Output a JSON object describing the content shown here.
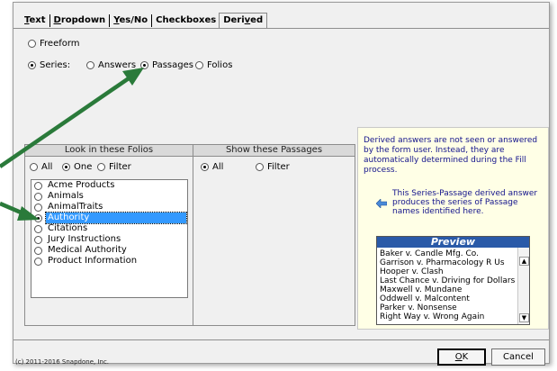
{
  "tabs": [
    {
      "pre": "",
      "ul": "T",
      "post": "ext"
    },
    {
      "pre": "",
      "ul": "D",
      "post": "ropdown"
    },
    {
      "pre": "",
      "ul": "Y",
      "post": "es/No"
    },
    {
      "pre": "Checkboxes",
      "ul": "",
      "post": ""
    },
    {
      "pre": "Deri",
      "ul": "v",
      "post": "ed"
    }
  ],
  "options": {
    "freeform": "Freeform",
    "series": "Series:",
    "answers": "Answers",
    "passages": "Passages",
    "folios": "Folios"
  },
  "panel": {
    "left_head": "Look in these Folios",
    "right_head": "Show these Passages",
    "all": "All",
    "one": "One",
    "filter": "Filter",
    "right_all": "All",
    "right_filter": "Filter"
  },
  "folios": [
    "Acme Products",
    "Animals",
    "AnimalTraits",
    "Authority",
    "Citations",
    "Jury Instructions",
    "Medical Authority",
    "Product Information"
  ],
  "selected_folio": "Authority",
  "info": {
    "text": "Derived answers are not seen or answered by the form user.  Instead, they are automatically determined during the Fill process.",
    "note": "This Series-Passage derived answer produces the series of Passage names identified here."
  },
  "preview": {
    "title": "Preview",
    "items": [
      "Baker v. Candle Mfg. Co.",
      "Garrison v. Pharmacology R Us",
      "Hooper v. Clash",
      "Last Chance v. Driving for Dollars",
      "Maxwell v. Mundane",
      "Oddwell v. Malcontent",
      "Parker v. Nonsense",
      "Right Way v. Wrong Again"
    ]
  },
  "footer": {
    "copyright": "(c) 2011-2016 Snapdone, Inc.",
    "ok_ul": "O",
    "ok_rest": "K",
    "cancel": "Cancel"
  },
  "colors": {
    "arrow": "#2a7a3a",
    "info_text": "#14148c",
    "selection": "#3399ff",
    "preview_head": "#2a5aa8"
  }
}
